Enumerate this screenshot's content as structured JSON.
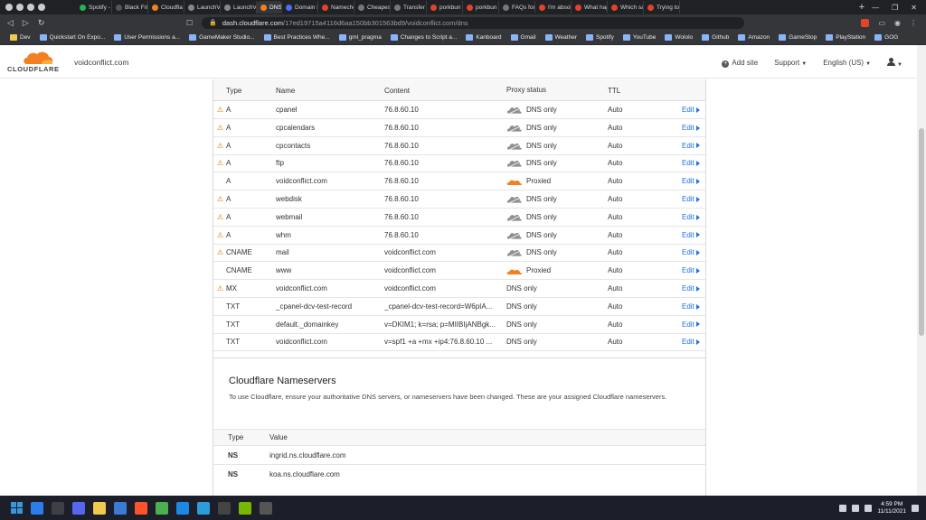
{
  "browser": {
    "tabs": [
      {
        "title": "Spotify -",
        "color": "#1db954"
      },
      {
        "title": "Black Fri",
        "color": "#555"
      },
      {
        "title": "Cloudfla",
        "color": "#f38020"
      },
      {
        "title": "LaunchVi",
        "color": "#888"
      },
      {
        "title": "LaunchVi",
        "color": "#888"
      },
      {
        "title": "DNS",
        "color": "#f38020",
        "active": true
      },
      {
        "title": "Domain N",
        "color": "#4c6ef5"
      },
      {
        "title": "Nameche",
        "color": "#e24329"
      },
      {
        "title": "Cheapest",
        "color": "#777"
      },
      {
        "title": "Transfer",
        "color": "#777"
      },
      {
        "title": "porkbun",
        "color": "#e24329"
      },
      {
        "title": "porkbun",
        "color": "#e24329"
      },
      {
        "title": "FAQs for",
        "color": "#777"
      },
      {
        "title": "I'm absol",
        "color": "#e24329"
      },
      {
        "title": "What hap",
        "color": "#e24329"
      },
      {
        "title": "Which sa",
        "color": "#e24329"
      },
      {
        "title": "Trying to",
        "color": "#e24329"
      }
    ],
    "new_tab": "+",
    "url_host": "dash.cloudflare.com",
    "url_path": "/17ed19715a4116d6aa150bb301563bd9/voidconflict.com/dns",
    "bookmarks": [
      {
        "label": "Dev",
        "folder": true
      },
      {
        "label": "Quickstart On Expo..."
      },
      {
        "label": "User Permissions a..."
      },
      {
        "label": "GameMaker Studio..."
      },
      {
        "label": "Best Practices Whe..."
      },
      {
        "label": "gml_pragma"
      },
      {
        "label": "Changes to Script a..."
      },
      {
        "label": "Kanboard"
      },
      {
        "label": "Gmail"
      },
      {
        "label": "Weather"
      },
      {
        "label": "Spotify"
      },
      {
        "label": "YouTube"
      },
      {
        "label": "Wololo"
      },
      {
        "label": "Github"
      },
      {
        "label": "Amazon"
      },
      {
        "label": "GameStop"
      },
      {
        "label": "PlayStation"
      },
      {
        "label": "GOG"
      }
    ]
  },
  "header": {
    "logo_text": "CLOUDFLARE",
    "domain": "voidconflict.com",
    "add_site": "Add site",
    "support": "Support",
    "language": "English (US)"
  },
  "dns": {
    "columns": {
      "type": "Type",
      "name": "Name",
      "content": "Content",
      "proxy": "Proxy status",
      "ttl": "TTL"
    },
    "edit_label": "Edit",
    "records": [
      {
        "warn": true,
        "type": "A",
        "name": "cpanel",
        "content": "76.8.60.10",
        "proxy": "DNS only",
        "cloud": "grey",
        "ttl": "Auto"
      },
      {
        "warn": true,
        "type": "A",
        "name": "cpcalendars",
        "content": "76.8.60.10",
        "proxy": "DNS only",
        "cloud": "grey",
        "ttl": "Auto"
      },
      {
        "warn": true,
        "type": "A",
        "name": "cpcontacts",
        "content": "76.8.60.10",
        "proxy": "DNS only",
        "cloud": "grey",
        "ttl": "Auto"
      },
      {
        "warn": true,
        "type": "A",
        "name": "ftp",
        "content": "76.8.60.10",
        "proxy": "DNS only",
        "cloud": "grey",
        "ttl": "Auto"
      },
      {
        "warn": false,
        "type": "A",
        "name": "voidconflict.com",
        "content": "76.8.60.10",
        "proxy": "Proxied",
        "cloud": "orange",
        "ttl": "Auto"
      },
      {
        "warn": true,
        "type": "A",
        "name": "webdisk",
        "content": "76.8.60.10",
        "proxy": "DNS only",
        "cloud": "grey",
        "ttl": "Auto"
      },
      {
        "warn": true,
        "type": "A",
        "name": "webmail",
        "content": "76.8.60.10",
        "proxy": "DNS only",
        "cloud": "grey",
        "ttl": "Auto"
      },
      {
        "warn": true,
        "type": "A",
        "name": "whm",
        "content": "76.8.60.10",
        "proxy": "DNS only",
        "cloud": "grey",
        "ttl": "Auto"
      },
      {
        "warn": true,
        "type": "CNAME",
        "name": "mail",
        "content": "voidconflict.com",
        "proxy": "DNS only",
        "cloud": "grey",
        "ttl": "Auto"
      },
      {
        "warn": false,
        "type": "CNAME",
        "name": "www",
        "content": "voidconflict.com",
        "proxy": "Proxied",
        "cloud": "orange",
        "ttl": "Auto"
      },
      {
        "warn": true,
        "type": "MX",
        "name": "voidconflict.com",
        "content": "voidconflict.com",
        "proxy": "DNS only",
        "cloud": "none",
        "ttl": "Auto"
      },
      {
        "warn": false,
        "type": "TXT",
        "name": "_cpanel-dcv-test-record",
        "content": "_cpanel-dcv-test-record=W6pIA...",
        "proxy": "DNS only",
        "cloud": "none",
        "ttl": "Auto"
      },
      {
        "warn": false,
        "type": "TXT",
        "name": "default._domainkey",
        "content": "v=DKIM1; k=rsa; p=MIIBIjANBgk...",
        "proxy": "DNS only",
        "cloud": "none",
        "ttl": "Auto"
      },
      {
        "warn": false,
        "type": "TXT",
        "name": "voidconflict.com",
        "content": "v=spf1 +a +mx +ip4:76.8.60.10 ...",
        "proxy": "DNS only",
        "cloud": "none",
        "ttl": "Auto"
      }
    ]
  },
  "nameservers": {
    "title": "Cloudflare Nameservers",
    "description": "To use Cloudflare, ensure your authoritative DNS servers, or nameservers have been changed. These are your assigned Cloudflare nameservers.",
    "col_type": "Type",
    "col_value": "Value",
    "rows": [
      {
        "type": "NS",
        "value": "ingrid.ns.cloudflare.com"
      },
      {
        "type": "NS",
        "value": "koa.ns.cloudflare.com"
      }
    ]
  },
  "taskbar": {
    "time": "4:59 PM",
    "date": "11/11/2021",
    "apps": [
      "#2b7de9",
      "#3f3f46",
      "#5865f2",
      "#f2c94c",
      "#3a7bd5",
      "#fb542b",
      "#4caf50",
      "#1e88e5",
      "#2d9cdb",
      "#444",
      "#76b900",
      "#555"
    ]
  },
  "colors": {
    "accent_link": "#1f6feb",
    "cloudflare_orange": "#f38020",
    "warning": "#d17a00"
  }
}
